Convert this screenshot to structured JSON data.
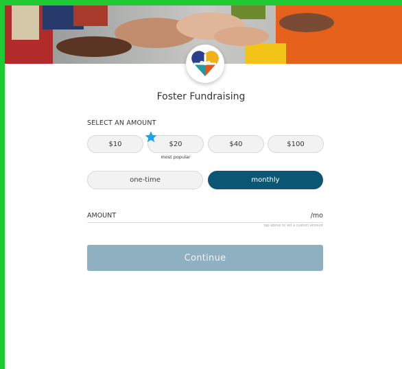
{
  "title": "Foster Fundraising",
  "select_label": "SELECT AN AMOUNT",
  "amounts": [
    "$10",
    "$20",
    "$40",
    "$100"
  ],
  "popular_label": "most popular",
  "frequency": {
    "one_time": "one-time",
    "monthly": "monthly",
    "selected": "monthly"
  },
  "amount_field": {
    "label": "AMOUNT",
    "suffix": "/mo",
    "hint": "tap above to set a custom amount"
  },
  "continue_label": "Continue",
  "colors": {
    "accent": "#0b5672",
    "continue_bg": "#8eb0c1",
    "star": "#1aa5e6",
    "frame": "#1ec932"
  }
}
